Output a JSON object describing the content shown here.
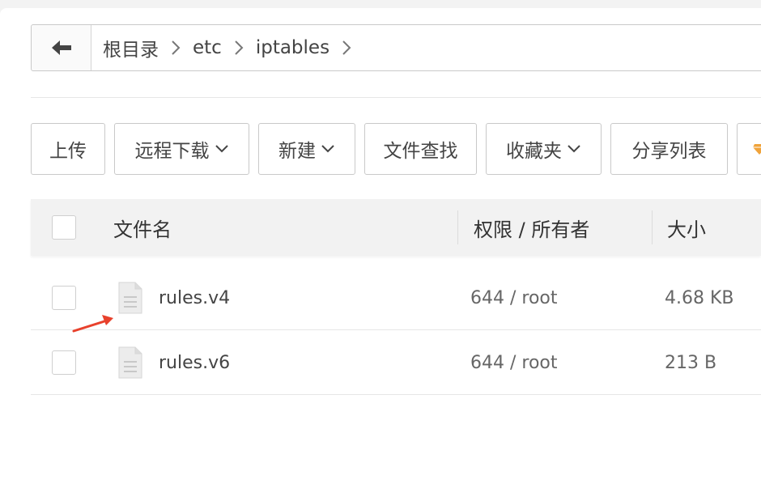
{
  "breadcrumb": {
    "back_icon": "arrow-left-icon",
    "items": [
      "根目录",
      "etc",
      "iptables"
    ],
    "separator_icon": "chevron-right-icon"
  },
  "toolbar": {
    "upload": "上传",
    "remote_download": "远程下载",
    "new": "新建",
    "file_search": "文件查找",
    "favorites": "收藏夹",
    "share_list": "分享列表",
    "extra_icon": "diamond-icon"
  },
  "table": {
    "headers": {
      "name": "文件名",
      "permission_owner": "权限 / 所有者",
      "size": "大小"
    },
    "rows": [
      {
        "name": "rules.v4",
        "perm": "644 / root",
        "size": "4.68 KB"
      },
      {
        "name": "rules.v6",
        "perm": "644 / root",
        "size": "213 B"
      }
    ]
  },
  "colors": {
    "annotation_arrow": "#e8412c",
    "accent_icon": "#f0a33a",
    "border": "#c9c9c9"
  }
}
